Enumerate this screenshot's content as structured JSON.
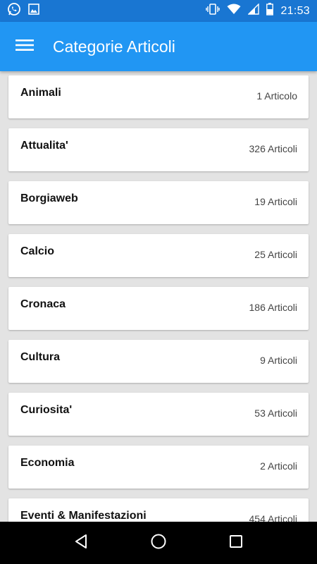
{
  "status_bar": {
    "time": "21:53",
    "left_icons": [
      "whatsapp-icon",
      "image-icon"
    ],
    "right_icons": [
      "vibrate-icon",
      "wifi-icon",
      "signal-icon",
      "battery-icon"
    ]
  },
  "app_bar": {
    "title": "Categorie Articoli",
    "menu_icon": "hamburger-menu-icon"
  },
  "categories": [
    {
      "name": "Animali",
      "count": "1 Articolo"
    },
    {
      "name": "Attualita'",
      "count": "326 Articoli"
    },
    {
      "name": "Borgiaweb",
      "count": "19 Articoli"
    },
    {
      "name": "Calcio",
      "count": "25 Articoli"
    },
    {
      "name": "Cronaca",
      "count": "186 Articoli"
    },
    {
      "name": "Cultura",
      "count": "9 Articoli"
    },
    {
      "name": "Curiosita'",
      "count": "53 Articoli"
    },
    {
      "name": "Economia",
      "count": "2 Articoli"
    },
    {
      "name": "Eventi & Manifestazioni",
      "count": "454 Articoli"
    }
  ],
  "nav_bar": {
    "back_icon": "back-icon",
    "home_icon": "home-icon",
    "recents_icon": "recents-icon"
  },
  "colors": {
    "status_bar": "#1976d2",
    "app_bar": "#2196f3",
    "background": "#e3e3e3",
    "card": "#ffffff",
    "nav_bar": "#000000"
  }
}
